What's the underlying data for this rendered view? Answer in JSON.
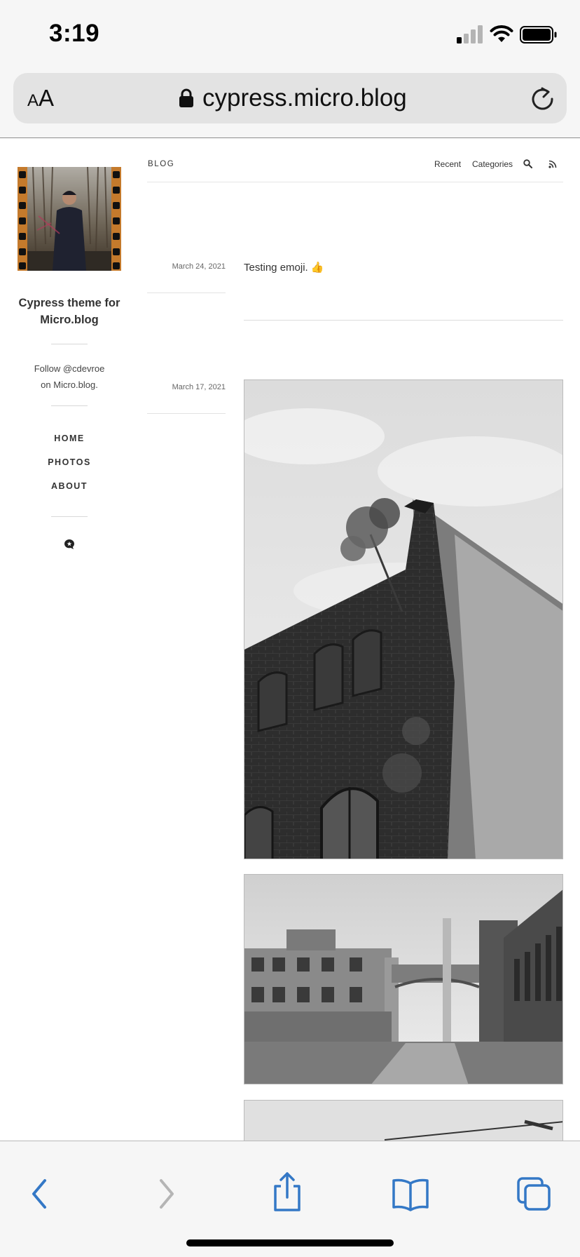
{
  "status_bar": {
    "time": "3:19"
  },
  "address_bar": {
    "text_size_small": "A",
    "text_size_large": "A",
    "url": "cypress.micro.blog"
  },
  "sidebar": {
    "site_title": "Cypress theme for Micro.blog",
    "follow_line1": "Follow @cdevroe",
    "follow_line2": "on Micro.blog.",
    "nav": [
      "HOME",
      "PHOTOS",
      "ABOUT"
    ]
  },
  "header": {
    "blog_label": "BLOG",
    "links": [
      "Recent",
      "Categories"
    ]
  },
  "posts": [
    {
      "date": "March 24, 2021",
      "text": "Testing emoji. 👍"
    },
    {
      "date": "March 17, 2021"
    }
  ],
  "icons": {
    "lock": "lock-icon",
    "reload": "reload-icon",
    "search": "search-icon",
    "rss": "rss-icon",
    "microblog": "microblog-icon",
    "back": "back-chevron-icon",
    "forward": "forward-chevron-icon",
    "share": "share-icon",
    "bookmarks": "book-icon",
    "tabs": "tabs-icon"
  },
  "colors": {
    "safari_blue": "#3478c6",
    "disabled_gray": "#b5b5b5"
  }
}
